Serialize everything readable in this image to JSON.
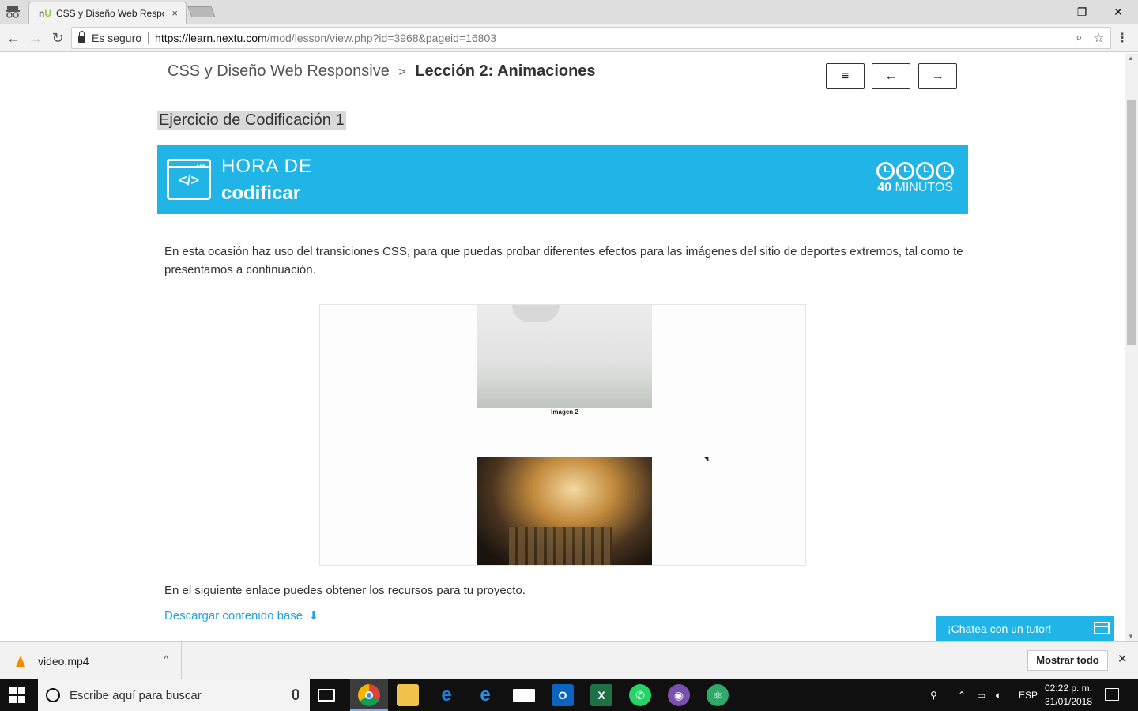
{
  "browser": {
    "tab_title": "CSS y Diseño Web Respo",
    "tab_close": "×",
    "secure_label": "Es seguro",
    "url_host": "https://learn.nextu.com",
    "url_path": "/mod/lesson/view.php?id=3968&pageid=16803",
    "min": "—",
    "restore": "❐",
    "close": "✕"
  },
  "header": {
    "course": "CSS y Diseño Web Responsive",
    "separator": ">",
    "lesson": "Lección 2: Animaciones",
    "menu_icon": "≡",
    "prev_icon": "←",
    "next_icon": "→"
  },
  "content": {
    "exercise_title": "Ejercicio de Codificación 1",
    "banner_line1": "HORA DE",
    "banner_line2": "codificar",
    "banner_icon_symbol": "</>",
    "duration_number": "40",
    "duration_unit": "MINUTOS",
    "intro": "En esta ocasión haz uso del transiciones CSS, para que puedas probar diferentes efectos para las imágenes del sitio de deportes extremos, tal como te presentamos a continuación.",
    "image2_caption": "Imagen 2",
    "resources_text": "En el siguiente enlace puedes obtener los recursos para tu proyecto.",
    "download_link": "Descargar contenido base",
    "download_icon": "⬇"
  },
  "chat": {
    "label": "¡Chatea con un tutor!"
  },
  "download_bar": {
    "file": "video.mp4",
    "chevron": "^",
    "show_all": "Mostrar todo",
    "close": "✕"
  },
  "taskbar": {
    "search_placeholder": "Escribe aquí para buscar",
    "lang": "ESP",
    "time": "02:22 p. m.",
    "date": "31/01/2018"
  },
  "colors": {
    "accent": "#20b5e6",
    "link": "#20a3d6"
  }
}
